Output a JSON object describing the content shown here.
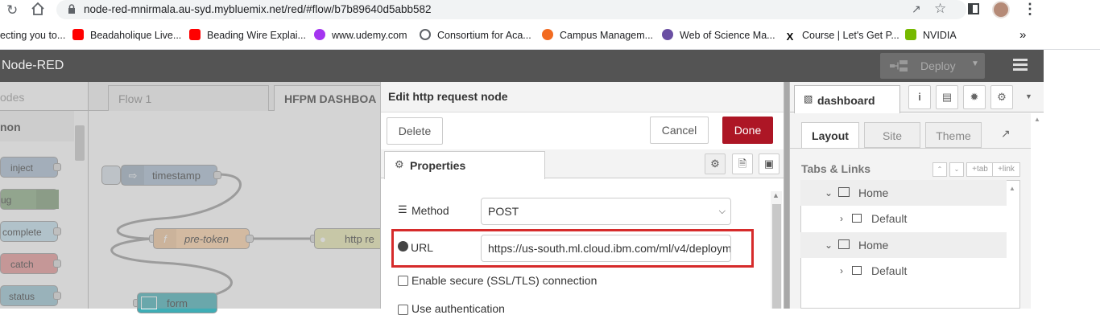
{
  "browser": {
    "url": "node-red-mnirmala.au-syd.mybluemix.net/red/#flow/b7b89640d5abb582",
    "bookmarks": [
      {
        "label": "ecting you to...",
        "icon": "globe-icon"
      },
      {
        "label": "Beadaholique Live...",
        "icon": "youtube-icon"
      },
      {
        "label": "Beading Wire Explai...",
        "icon": "youtube-icon"
      },
      {
        "label": "www.udemy.com",
        "icon": "udemy-icon"
      },
      {
        "label": "Consortium for Aca...",
        "icon": "globe-icon"
      },
      {
        "label": "Campus Managem...",
        "icon": "campus-icon"
      },
      {
        "label": "Web of Science Ma...",
        "icon": "wos-icon"
      },
      {
        "label": "Course | Let's Get P...",
        "icon": "x-icon"
      },
      {
        "label": "NVIDIA",
        "icon": "nvidia-icon"
      }
    ],
    "more": "»"
  },
  "header": {
    "title": "Node-RED",
    "deploy_label": "Deploy"
  },
  "tabs": {
    "palette_tab": "odes",
    "flow1": "Flow 1",
    "flow2": "HFPM DASHBOA"
  },
  "palette": {
    "category": "non",
    "nodes": [
      "inject",
      "ug",
      "complete",
      "catch",
      "status"
    ]
  },
  "flow_nodes": {
    "timestamp": "timestamp",
    "pretoken": "pre-token",
    "http": "http re",
    "form": "form"
  },
  "dialog": {
    "title": "Edit http request node",
    "delete_label": "Delete",
    "cancel_label": "Cancel",
    "done_label": "Done",
    "properties_tab": "Properties",
    "method_label": "Method",
    "method_value": "POST",
    "url_label": "URL",
    "url_value": "https://us-south.ml.cloud.ibm.com/ml/v4/deploym",
    "ssl_label": "Enable secure (SSL/TLS) connection",
    "auth_label": "Use authentication",
    "highlight_color": "#d62b2b"
  },
  "sidebar": {
    "tab_label": "dashboard",
    "subtabs": [
      "Layout",
      "Site",
      "Theme"
    ],
    "section_title": "Tabs & Links",
    "tab_btn": "tab",
    "link_btn": "link",
    "tree": [
      {
        "type": "tab",
        "label": "Home"
      },
      {
        "type": "group",
        "label": "Default"
      },
      {
        "type": "tab",
        "label": "Home"
      },
      {
        "type": "group",
        "label": "Default"
      }
    ]
  },
  "colors": {
    "done_button": "#ad1625",
    "header": "#545454"
  }
}
